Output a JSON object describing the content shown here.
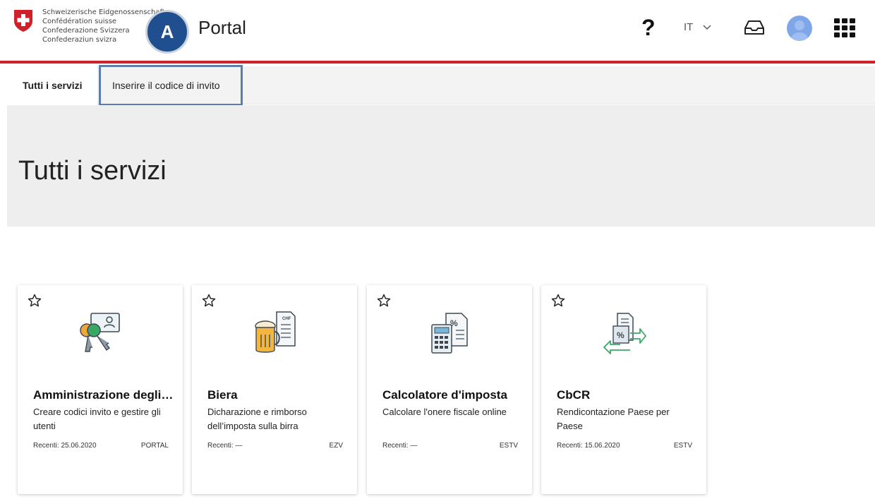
{
  "header": {
    "logo_lines": [
      "Schweizerische Eidgenossenschaft",
      "Confédération suisse",
      "Confederazione Svizzera",
      "Confederaziun svizra"
    ],
    "badge": "A",
    "title": "Portal",
    "help": "?",
    "language": "IT"
  },
  "tabs": [
    {
      "label": "Tutti i servizi",
      "active": true
    },
    {
      "label": "Inserire il codice di invito",
      "active": false
    }
  ],
  "page_title": "Tutti i servizi",
  "cards": [
    {
      "title": "Amministrazione degli…",
      "description": "Creare codici invito e gestire gli utenti",
      "recent": "Recenti: 25.06.2020",
      "org": "PORTAL",
      "icon": "keys-id-card-icon"
    },
    {
      "title": "Biera",
      "description": "Dicharazione e rimborso dell’imposta sulla birra",
      "recent": "Recenti: —",
      "org": "EZV",
      "icon": "beer-mug-document-icon"
    },
    {
      "title": "Calcolatore d'imposta",
      "description": "Calcolare l'onere fiscale online",
      "recent": "Recenti: —",
      "org": "ESTV",
      "icon": "calculator-document-icon"
    },
    {
      "title": "CbCR",
      "description": "Rendicontazione Paese per Paese",
      "recent": "Recenti: 15.06.2020",
      "org": "ESTV",
      "icon": "document-exchange-arrows-icon"
    }
  ],
  "colors": {
    "accent_red": "#d0202a",
    "badge_blue": "#1f4f8f",
    "highlight_border": "#5c7ea8"
  }
}
